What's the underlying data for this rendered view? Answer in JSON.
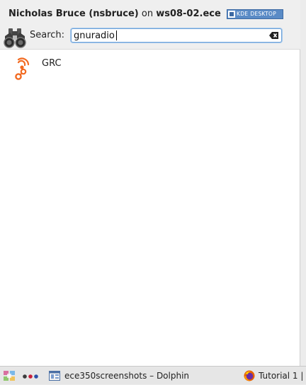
{
  "header": {
    "user_name": "Nicholas Bruce (nsbruce)",
    "on_text": "on",
    "host": "ws08-02.ece",
    "badge_kde": "KDE",
    "badge_desktop": "DESKTOP"
  },
  "search": {
    "label": "Search:",
    "value": "gnuradio"
  },
  "results": [
    {
      "label": "GRC",
      "icon": "grc-icon"
    }
  ],
  "taskbar": {
    "tasks": [
      {
        "label": "ece350screenshots – Dolphin",
        "icon": "dolphin-icon"
      },
      {
        "label": "Tutorial 1 |",
        "icon": "firefox-icon"
      }
    ]
  },
  "colors": {
    "accent": "#6fa3d9",
    "grc_orange": "#f26a21",
    "kde_blue": "#5a8bc6"
  }
}
